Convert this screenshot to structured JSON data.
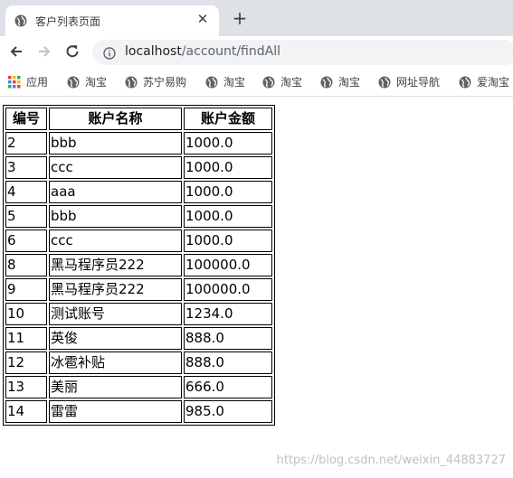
{
  "tab": {
    "title": "客户列表页面",
    "close_icon": "close-icon"
  },
  "toolbar": {
    "url_host": "localhost",
    "url_path": "/account/findAll"
  },
  "bookmarks": [
    {
      "label": "应用",
      "icon": "apps-grid-icon"
    },
    {
      "label": "淘宝",
      "icon": "globe-icon"
    },
    {
      "label": "苏宁易购",
      "icon": "globe-icon"
    },
    {
      "label": "淘宝",
      "icon": "globe-icon"
    },
    {
      "label": "淘宝",
      "icon": "globe-icon"
    },
    {
      "label": "淘宝",
      "icon": "globe-icon"
    },
    {
      "label": "网址导航",
      "icon": "globe-icon"
    },
    {
      "label": "爱淘宝",
      "icon": "globe-icon"
    }
  ],
  "table": {
    "headers": [
      "编号",
      "账户名称",
      "账户金额"
    ],
    "rows": [
      [
        "2",
        "bbb",
        "1000.0"
      ],
      [
        "3",
        "ccc",
        "1000.0"
      ],
      [
        "4",
        "aaa",
        "1000.0"
      ],
      [
        "5",
        "bbb",
        "1000.0"
      ],
      [
        "6",
        "ccc",
        "1000.0"
      ],
      [
        "8",
        "黑马程序员222",
        "100000.0"
      ],
      [
        "9",
        "黑马程序员222",
        "100000.0"
      ],
      [
        "10",
        "测试账号",
        "1234.0"
      ],
      [
        "11",
        "英俊",
        "888.0"
      ],
      [
        "12",
        "冰雹补贴",
        "888.0"
      ],
      [
        "13",
        "美丽",
        "666.0"
      ],
      [
        "14",
        "雷雷",
        "985.0"
      ]
    ]
  },
  "watermark": "https://blog.csdn.net/weixin_44883727",
  "colors": {
    "tabstrip_bg": "#dee1e6",
    "omnibox_bg": "#f1f3f4"
  }
}
